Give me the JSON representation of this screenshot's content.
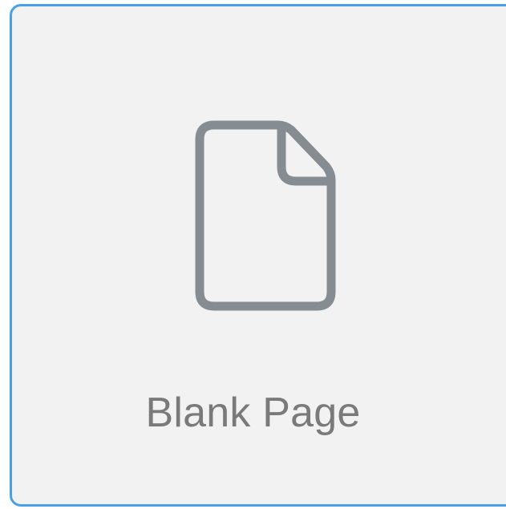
{
  "card": {
    "label": "Blank Page",
    "icon": "blank-document-icon",
    "selected": true,
    "accent_color": "#4aa0e6",
    "background_color": "#f2f2f2",
    "icon_color": "#858c92",
    "label_color": "#7a7a7a"
  }
}
